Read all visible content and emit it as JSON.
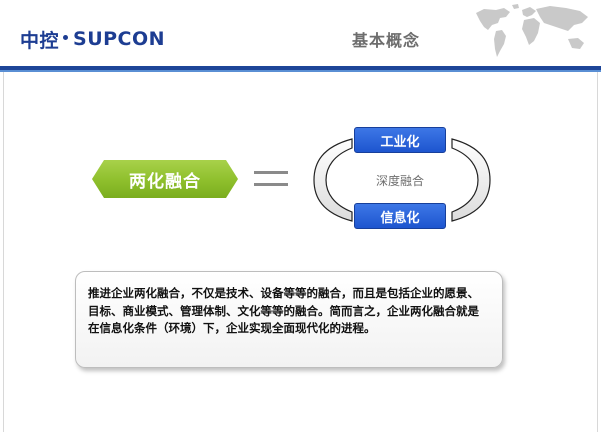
{
  "header": {
    "logo_cn": "中控",
    "logo_en": "SUPCON",
    "title": "基本概念"
  },
  "concept": {
    "label": "两化融合",
    "equals": "="
  },
  "cycle": {
    "top": "工业化",
    "center": "深度融合",
    "bottom": "信息化"
  },
  "description": {
    "text": "推进企业两化融合，不仅是技术、设备等等的融合，而且是包括企业的愿景、目标、商业模式、管理体制、文化等等的融合。简而言之，企业两化融合就是在信息化条件（环境）下，企业实现全面现代化的进程。"
  },
  "colors": {
    "brand_blue": "#1d3d92",
    "concept_green": "#8ebf2c",
    "box_blue": "#1d55cf"
  }
}
